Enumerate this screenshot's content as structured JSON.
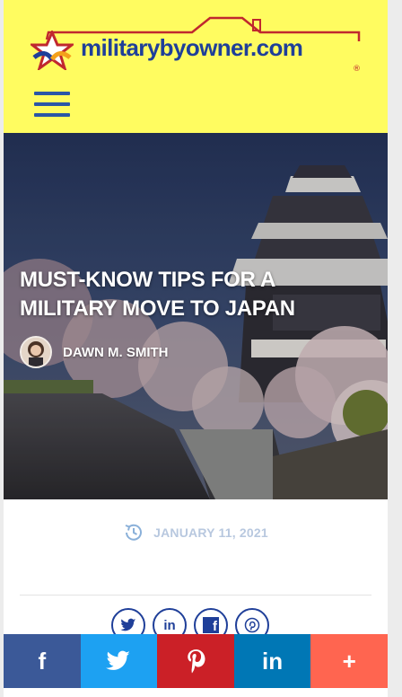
{
  "header": {
    "logo_text": "militarybyowner.com",
    "logo_reg": "®",
    "menu_icon": "hamburger-menu-icon",
    "bg_color": "#fffc60",
    "brand_blue": "#1f3f99",
    "brand_red": "#c0282e"
  },
  "article": {
    "title": "MUST-KNOW TIPS FOR A MILITARY MOVE TO JAPAN",
    "author": "DAWN M. SMITH",
    "date": "JANUARY 11, 2021",
    "date_icon": "clock-history-icon"
  },
  "inline_share": [
    {
      "name": "twitter",
      "icon": "twitter-bird-icon"
    },
    {
      "name": "linkedin",
      "label": "in",
      "icon": "linkedin-icon"
    },
    {
      "name": "facebook",
      "label": "f",
      "icon": "facebook-icon"
    },
    {
      "name": "pinterest",
      "icon": "pinterest-icon"
    }
  ],
  "share_bar": [
    {
      "name": "facebook",
      "label": "f",
      "color": "#3b5998",
      "icon": "facebook-icon"
    },
    {
      "name": "twitter",
      "color": "#1da1f2",
      "icon": "twitter-bird-icon"
    },
    {
      "name": "pinterest",
      "color": "#cb2027",
      "icon": "pinterest-icon"
    },
    {
      "name": "linkedin",
      "label": "in",
      "color": "#0077b5",
      "icon": "linkedin-icon"
    },
    {
      "name": "more",
      "label": "+",
      "color": "#ff6550",
      "icon": "plus-icon"
    }
  ]
}
